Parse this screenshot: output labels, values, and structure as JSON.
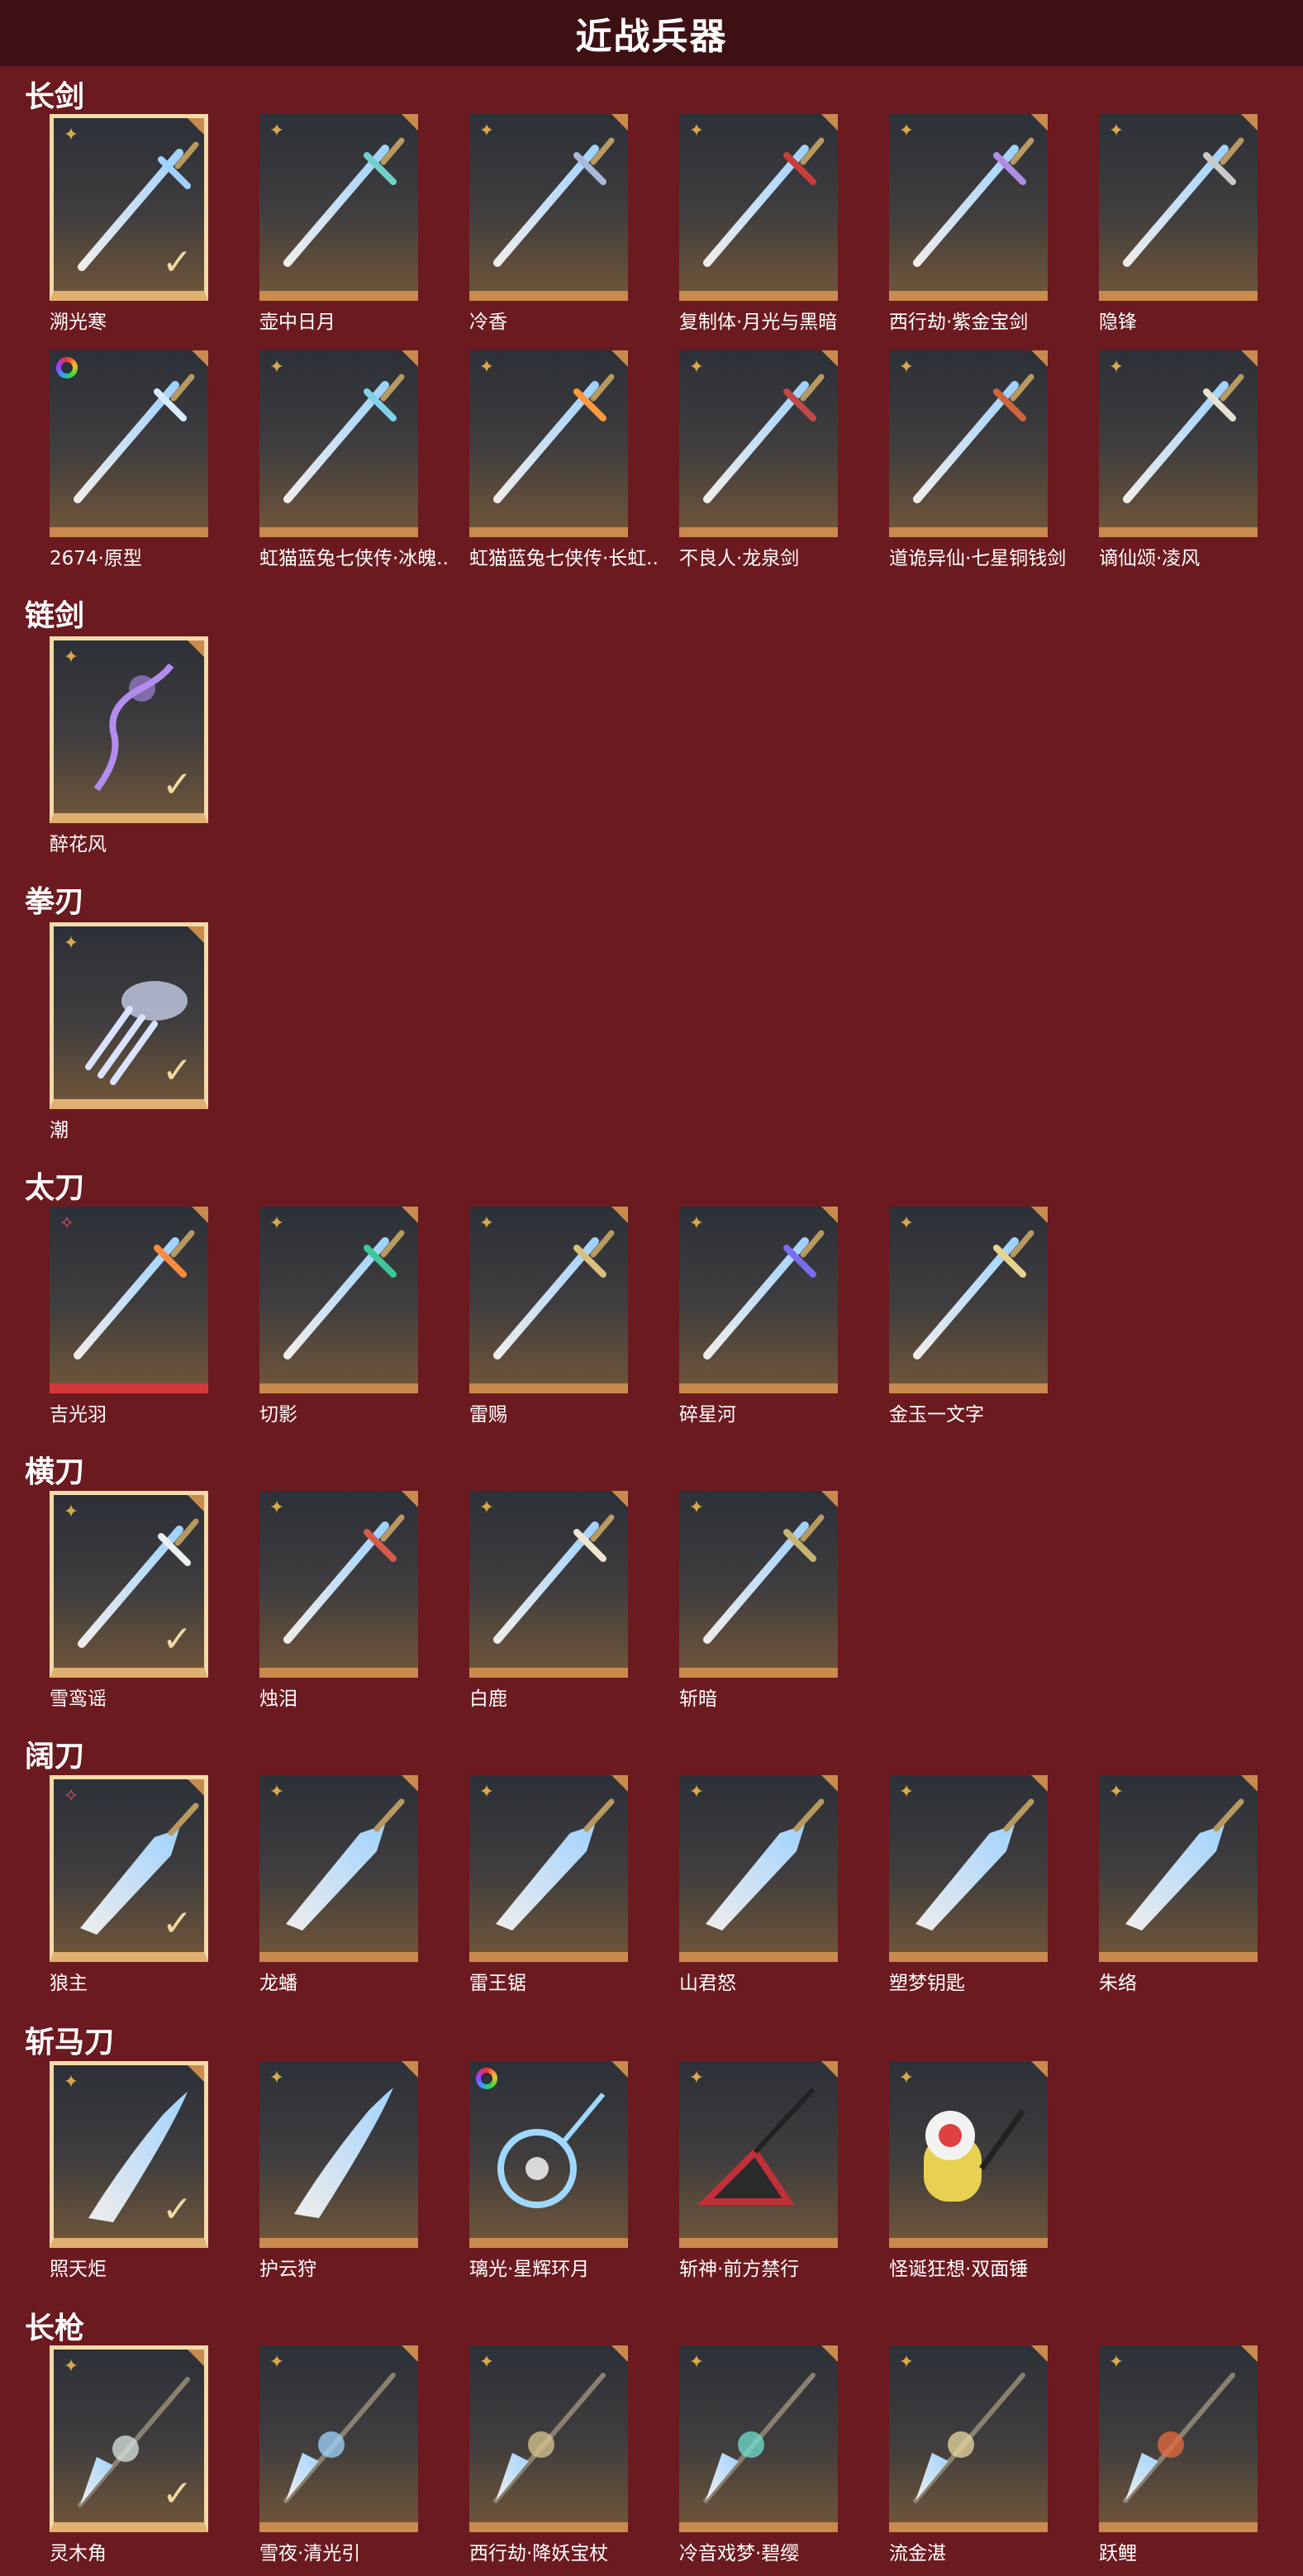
{
  "page_title": "近战兵器",
  "colors": {
    "background": "#6b1a1f",
    "header": "#3d1014",
    "tile_bottom": "#c98a4e",
    "selected_border": "#f2dca8"
  },
  "sections": [
    {
      "title": "长剑",
      "items": [
        {
          "name": "溯光寒",
          "badge": "star-icon",
          "selected": true,
          "art": "sword",
          "color": "#9fd2ff"
        },
        {
          "name": "壶中日月",
          "badge": "star-icon",
          "selected": false,
          "art": "sword",
          "color": "#6fd0c8"
        },
        {
          "name": "冷香",
          "badge": "star-icon",
          "selected": false,
          "art": "sword",
          "color": "#a9b9d9"
        },
        {
          "name": "复制体·月光与黑暗",
          "badge": "star-icon",
          "selected": false,
          "art": "sword",
          "color": "#c83c3c"
        },
        {
          "name": "西行劫·紫金宝剑",
          "badge": "star-icon",
          "selected": false,
          "art": "sword",
          "color": "#b08ce6"
        },
        {
          "name": "隐锋",
          "badge": "star-icon",
          "selected": false,
          "art": "sword",
          "color": "#c9c9c9"
        },
        {
          "name": "2674·原型",
          "badge": "rainbow-ring-icon",
          "selected": false,
          "art": "sword",
          "color": "#d8ecff"
        },
        {
          "name": "虹猫蓝兔七侠传·冰魄..",
          "badge": "star-icon",
          "selected": false,
          "art": "sword",
          "color": "#7fd2ea"
        },
        {
          "name": "虹猫蓝兔七侠传·长虹..",
          "badge": "star-icon",
          "selected": false,
          "art": "sword",
          "color": "#ff9a3c"
        },
        {
          "name": "不良人·龙泉剑",
          "badge": "star-icon",
          "selected": false,
          "art": "sword",
          "color": "#c04848"
        },
        {
          "name": "道诡异仙·七星铜钱剑",
          "badge": "star-icon",
          "selected": false,
          "art": "sword",
          "color": "#d0643c"
        },
        {
          "name": "谪仙颂·凌风",
          "badge": "star-icon",
          "selected": false,
          "art": "sword",
          "color": "#e6e2d0"
        }
      ]
    },
    {
      "title": "链剑",
      "items": [
        {
          "name": "醉花风",
          "badge": "star-icon",
          "selected": true,
          "art": "chain",
          "color": "#b38cf0"
        }
      ]
    },
    {
      "title": "拳刃",
      "items": [
        {
          "name": "潮",
          "badge": "star-icon",
          "selected": true,
          "art": "claw",
          "color": "#d9e2ff"
        }
      ]
    },
    {
      "title": "太刀",
      "items": [
        {
          "name": "吉光羽",
          "badge": "red-star-icon",
          "selected": false,
          "art": "katana",
          "color": "#ff8a3c",
          "red": true
        },
        {
          "name": "切影",
          "badge": "star-icon",
          "selected": false,
          "art": "katana",
          "color": "#3cc79a"
        },
        {
          "name": "雷赐",
          "badge": "star-icon",
          "selected": false,
          "art": "katana",
          "color": "#d9c07a"
        },
        {
          "name": "碎星河",
          "badge": "star-icon",
          "selected": false,
          "art": "katana",
          "color": "#7a6cf0"
        },
        {
          "name": "金玉一文字",
          "badge": "star-icon",
          "selected": false,
          "art": "katana",
          "color": "#e8d38c"
        }
      ]
    },
    {
      "title": "横刀",
      "items": [
        {
          "name": "雪鸾谣",
          "badge": "star-icon",
          "selected": true,
          "art": "saber",
          "color": "#e8f0f0"
        },
        {
          "name": "烛泪",
          "badge": "star-icon",
          "selected": false,
          "art": "saber",
          "color": "#d65a4a"
        },
        {
          "name": "白鹿",
          "badge": "star-icon",
          "selected": false,
          "art": "saber",
          "color": "#efe6cf"
        },
        {
          "name": "斩暗",
          "badge": "star-icon",
          "selected": false,
          "art": "saber",
          "color": "#c8b472"
        }
      ]
    },
    {
      "title": "阔刀",
      "items": [
        {
          "name": "狼主",
          "badge": "red-star-icon",
          "selected": true,
          "art": "broad",
          "color": "#b84040"
        },
        {
          "name": "龙蟠",
          "badge": "star-icon",
          "selected": false,
          "art": "broad",
          "color": "#6fd08a"
        },
        {
          "name": "雷王锯",
          "badge": "star-icon",
          "selected": false,
          "art": "broad",
          "color": "#8ec6f0"
        },
        {
          "name": "山君怒",
          "badge": "star-icon",
          "selected": false,
          "art": "broad",
          "color": "#d9c48a"
        },
        {
          "name": "塑梦钥匙",
          "badge": "star-icon",
          "selected": false,
          "art": "broad",
          "color": "#e0d3a6"
        },
        {
          "name": "朱络",
          "badge": "star-icon",
          "selected": false,
          "art": "broad",
          "color": "#e23c3c"
        }
      ]
    },
    {
      "title": "斩马刀",
      "items": [
        {
          "name": "照天炬",
          "badge": "star-icon",
          "selected": true,
          "art": "glaive",
          "color": "#ff8a2c"
        },
        {
          "name": "护云狩",
          "badge": "star-icon",
          "selected": false,
          "art": "glaive",
          "color": "#c9c08a"
        },
        {
          "name": "璃光·星辉环月",
          "badge": "rainbow-ring-icon",
          "selected": false,
          "art": "ring",
          "color": "#9fd8ff"
        },
        {
          "name": "斩神·前方禁行",
          "badge": "star-icon",
          "selected": false,
          "art": "sign",
          "color": "#c0303a"
        },
        {
          "name": "怪诞狂想·双面锤",
          "badge": "star-icon",
          "selected": false,
          "art": "hammer",
          "color": "#e8d050"
        }
      ]
    },
    {
      "title": "长枪",
      "items": [
        {
          "name": "灵木角",
          "badge": "star-icon",
          "selected": true,
          "art": "spear",
          "color": "#d8e6e2"
        },
        {
          "name": "雪夜·清光引",
          "badge": "star-icon",
          "selected": false,
          "art": "spear",
          "color": "#9fd6ff"
        },
        {
          "name": "西行劫·降妖宝杖",
          "badge": "star-icon",
          "selected": false,
          "art": "spear",
          "color": "#d8c890"
        },
        {
          "name": "冷音戏梦·碧缨",
          "badge": "star-icon",
          "selected": false,
          "art": "spear",
          "color": "#6fe0d0"
        },
        {
          "name": "流金湛",
          "badge": "star-icon",
          "selected": false,
          "art": "spear",
          "color": "#e8d9a0"
        },
        {
          "name": "跃鲤",
          "badge": "star-icon",
          "selected": false,
          "art": "spear",
          "color": "#e86a3c"
        }
      ]
    }
  ]
}
